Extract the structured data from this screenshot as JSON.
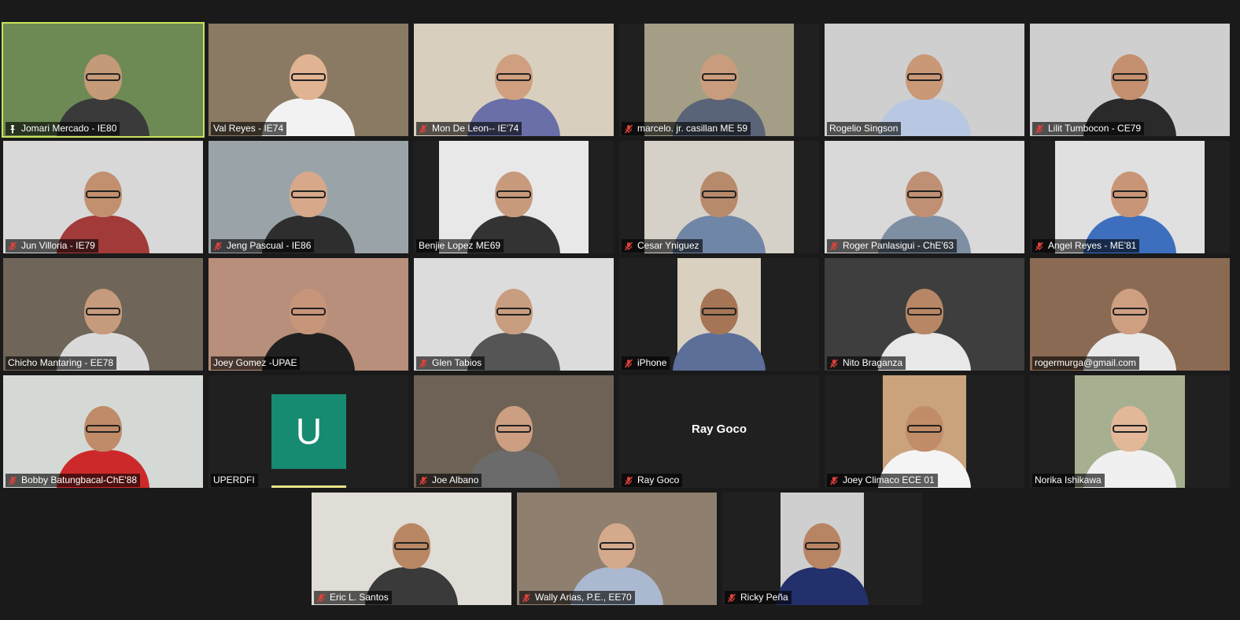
{
  "meeting": {
    "accent_active": "#c8e35a",
    "tiles": [
      {
        "name": "Jomari Mercado - IE80",
        "muted": false,
        "icon": "pin-icon",
        "active": true,
        "bg": "#6d8a55",
        "skin": "#c49a78",
        "shirt": "#3a3a3a"
      },
      {
        "name": "Val Reyes - IE74",
        "muted": false,
        "icon": "",
        "bg": "#8a7a63",
        "skin": "#e0b393",
        "shirt": "#f2f2f2"
      },
      {
        "name": "Mon De Leon-- IE'74",
        "muted": true,
        "icon": "mic-muted-icon",
        "bg": "#d8cfbf",
        "skin": "#cf9f7f",
        "shirt": "#6b6fa8"
      },
      {
        "name": "marcelo. jr. casillan ME 59",
        "muted": true,
        "icon": "mic-muted-icon",
        "bg": "#a49e86",
        "skin": "#c99c7d",
        "shirt": "#5a6478"
      },
      {
        "name": "Rogelio Singson",
        "muted": false,
        "icon": "",
        "bg": "#cfcfcf",
        "skin": "#c99877",
        "shirt": "#b9c8e2"
      },
      {
        "name": "Lilit Tumbocon - CE79",
        "muted": true,
        "icon": "mic-muted-icon",
        "bg": "#cfcfcf",
        "skin": "#c38f6e",
        "shirt": "#2a2a2a"
      },
      {
        "name": "Jun Villoria - IE79",
        "muted": true,
        "icon": "mic-muted-icon",
        "bg": "#d8d8d8",
        "skin": "#c2906f",
        "shirt": "#a23a3a"
      },
      {
        "name": "Jeng Pascual - IE86",
        "muted": true,
        "icon": "mic-muted-icon",
        "bg": "#9aa4a8",
        "skin": "#d7a889",
        "shirt": "#2e2e2e"
      },
      {
        "name": "Benjie Lopez ME69",
        "muted": false,
        "icon": "",
        "bg": "#e8e8e8",
        "skin": "#c89a7c",
        "shirt": "#333333"
      },
      {
        "name": "Cesar Yniguez",
        "muted": true,
        "icon": "mic-muted-icon",
        "bg": "#d6d1c8",
        "skin": "#b88a6c",
        "shirt": "#6f86a6"
      },
      {
        "name": "Roger Panlasigui - ChE'63",
        "muted": true,
        "icon": "mic-muted-icon",
        "bg": "#d9d9d9",
        "skin": "#c09074",
        "shirt": "#7e8ea3"
      },
      {
        "name": "Angel Reyes - ME'81",
        "muted": true,
        "icon": "mic-muted-icon",
        "bg": "#e0e0e0",
        "skin": "#c89676",
        "shirt": "#3e6fbf"
      },
      {
        "name": "Chicho Mantaring - EE78",
        "muted": false,
        "icon": "",
        "bg": "#6f6558",
        "skin": "#c69a7c",
        "shirt": "#dadada"
      },
      {
        "name": "Joey Gomez -UPAE",
        "muted": false,
        "icon": "",
        "bg": "#b88f7a",
        "skin": "#c7957a",
        "shirt": "#202020"
      },
      {
        "name": "Glen Tabios",
        "muted": true,
        "icon": "mic-muted-icon",
        "bg": "#dcdcdc",
        "skin": "#c99d80",
        "shirt": "#555555"
      },
      {
        "name": "iPhone",
        "muted": true,
        "icon": "mic-muted-icon",
        "bg": "#d9d0c0",
        "skin": "#a57556",
        "shirt": "#5c6f99"
      },
      {
        "name": "Nito Braganza",
        "muted": true,
        "icon": "mic-muted-icon",
        "bg": "#3e3e3e",
        "skin": "#b78765",
        "shirt": "#e8e8e8"
      },
      {
        "name": "rogermurga@gmail.com",
        "muted": false,
        "icon": "",
        "bg": "#8a6a52",
        "skin": "#cf9f82",
        "shirt": "#e9e9e9"
      },
      {
        "name": "Bobby Batungbacal-ChE'88",
        "muted": true,
        "icon": "mic-muted-icon",
        "bg": "#d5d9d5",
        "skin": "#bf8b68",
        "shirt": "#cc2a2a"
      },
      {
        "name": "UPERDFI",
        "muted": false,
        "icon": "",
        "avatar": "U",
        "bg": "#202020"
      },
      {
        "name": "Joe Albano",
        "muted": true,
        "icon": "mic-muted-icon",
        "bg": "#6e6256",
        "skin": "#cc9f82",
        "shirt": "#6b6b6b"
      },
      {
        "name": "Ray Goco",
        "muted": true,
        "icon": "mic-muted-icon",
        "center": "Ray Goco",
        "bg": "#202020"
      },
      {
        "name": "Joey Climaco ECE 01",
        "muted": true,
        "icon": "mic-muted-icon",
        "bg": "#caa27c",
        "skin": "#c18d68",
        "shirt": "#f4f4f4"
      },
      {
        "name": "Norika Ishikawa",
        "muted": false,
        "icon": "",
        "bg": "#a6b090",
        "skin": "#e2b899",
        "shirt": "#f0f0f0"
      },
      {
        "name": "Eric L. Santos",
        "muted": true,
        "icon": "mic-muted-icon",
        "bg": "#e0dcd6",
        "skin": "#b98763",
        "shirt": "#3a3a3a"
      },
      {
        "name": "Wally Arias, P.E., EE70",
        "muted": true,
        "icon": "mic-muted-icon",
        "bg": "#8f7f6e",
        "skin": "#d5a98c",
        "shirt": "#aab8d0"
      },
      {
        "name": "Ricky Peña",
        "muted": true,
        "icon": "mic-muted-icon",
        "bg": "#cfcfcf",
        "skin": "#b88564",
        "shirt": "#22306b"
      }
    ]
  }
}
